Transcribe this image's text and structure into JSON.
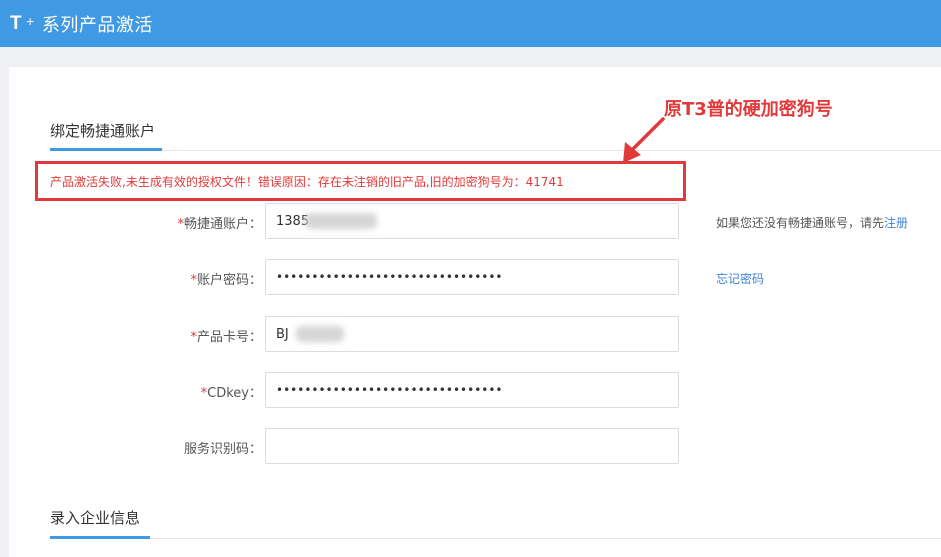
{
  "header": {
    "brand": "T",
    "brand_suffix": "+",
    "title": "系列产品激活"
  },
  "sections": {
    "account": "绑定畅捷通账户",
    "company": "录入企业信息"
  },
  "error": {
    "message": "产品激活失败,未生成有效的授权文件！错误原因：存在未注销的旧产品,旧的加密狗号为：41741"
  },
  "annotation": {
    "note": "原T3普的硬加密狗号"
  },
  "form": {
    "required_mark": "*",
    "account_label": "畅捷通账户：",
    "account_value": "1385",
    "password_label": "账户密码：",
    "password_value": "••••••••••••••••••••••••••••••••",
    "card_label": "产品卡号：",
    "card_value": "BJ",
    "cdkey_label": "CDkey：",
    "cdkey_value": "••••••••••••••••••••••••••••••••",
    "service_label": "服务识别码：",
    "service_value": ""
  },
  "side": {
    "register_hint": "如果您还没有畅捷通账号，请先",
    "register_link": "注册",
    "forgot_link": "忘记密码"
  },
  "colors": {
    "header_bg": "#3f9ae3",
    "error": "#e23a3a",
    "link": "#3f84d6"
  }
}
